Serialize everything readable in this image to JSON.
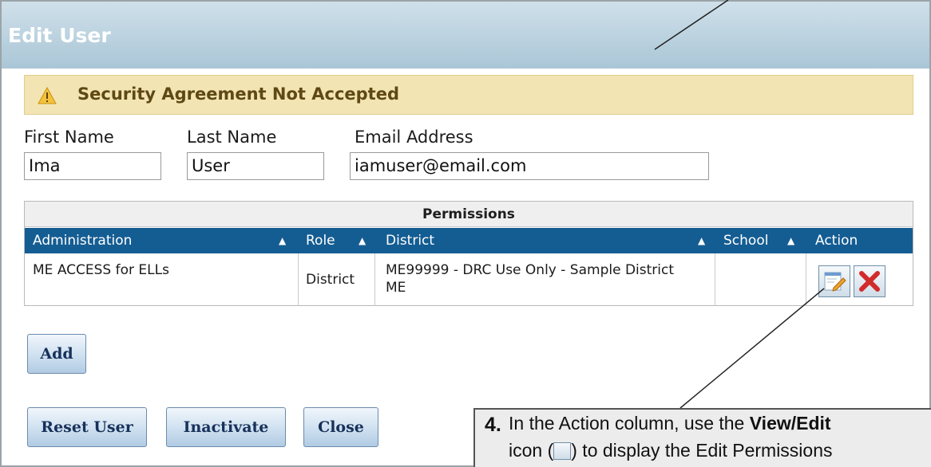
{
  "dialog": {
    "title": "Edit User"
  },
  "alert": {
    "text": "Security Agreement Not Accepted",
    "color": "#f3e4b4"
  },
  "form": {
    "first_name_label": "First Name",
    "first_name_value": "Ima",
    "last_name_label": "Last Name",
    "last_name_value": "User",
    "email_label": "Email Address",
    "email_value": "iamuser@email.com"
  },
  "permissions": {
    "title": "Permissions",
    "columns": [
      "Administration",
      "Role",
      "District",
      "School",
      "Action"
    ],
    "rows": [
      {
        "administration": "ME ACCESS for ELLs",
        "role": "District",
        "district_line1": "ME99999 - DRC Use Only - Sample District",
        "district_line2": "ME",
        "school": "",
        "actions": [
          "view-edit-icon",
          "delete-icon"
        ]
      }
    ],
    "header_color": "#145d93"
  },
  "buttons": {
    "add": "Add",
    "reset_user": "Reset User",
    "inactivate": "Inactivate",
    "close": "Close"
  },
  "callout": {
    "number": "4.",
    "line1_pre": "In the Action column, use the ",
    "line1_bold": "View/Edit",
    "line2_pre": "icon (",
    "line2_post": ") to display the Edit Permissions"
  }
}
